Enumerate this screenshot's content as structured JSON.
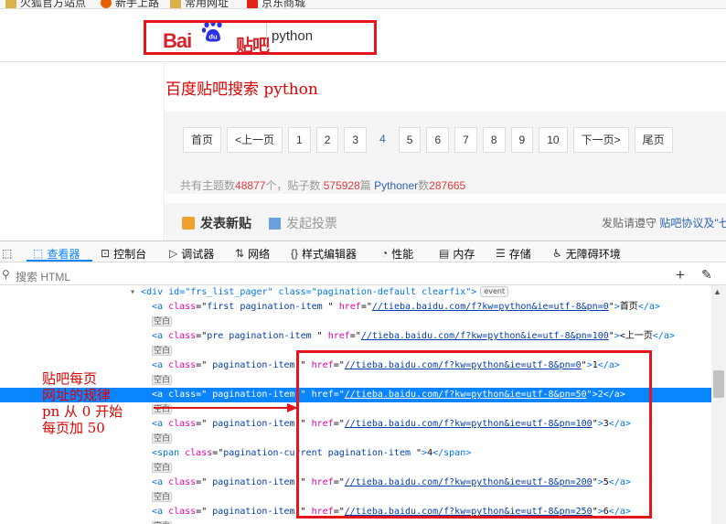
{
  "bookmarks": [
    {
      "label": "火狐官方站点",
      "icon": "folder-icon"
    },
    {
      "label": "新手上路",
      "icon": "firefox-icon"
    },
    {
      "label": "常用网址",
      "icon": "folder-icon"
    },
    {
      "label": "京东商城",
      "icon": "jd-icon"
    }
  ],
  "header": {
    "logo_bai": "Bai",
    "logo_du": "du",
    "logo_tieba": "贴吧",
    "search_value": "python"
  },
  "note_title": "百度贴吧搜索 python",
  "pager": {
    "items": [
      "首页",
      "<上一页",
      "1",
      "2",
      "3",
      "4",
      "5",
      "6",
      "7",
      "8",
      "9",
      "10",
      "下一页>",
      "尾页"
    ],
    "current": "4"
  },
  "stats": {
    "p1": "共有主题数",
    "topics": "48877",
    "p2": "个，贴子数 ",
    "posts": "575928",
    "p3": "篇 ",
    "member_label": "Pythoner",
    "p4": "数",
    "members": "287665"
  },
  "post_bar": {
    "new_post": "发表新贴",
    "vote": "发起投票",
    "rules_prefix": "发贴请遵守 ",
    "rules_link": "贴吧协议及\"七"
  },
  "devtools": {
    "tabs": [
      {
        "label": "查看器",
        "icon": "inspector-icon",
        "glyph": "⬚"
      },
      {
        "label": "控制台",
        "icon": "console-icon",
        "glyph": "⊡"
      },
      {
        "label": "调试器",
        "icon": "debugger-icon",
        "glyph": "▷"
      },
      {
        "label": "网络",
        "icon": "network-icon",
        "glyph": "⇅"
      },
      {
        "label": "样式编辑器",
        "icon": "style-editor-icon",
        "glyph": "{}"
      },
      {
        "label": "性能",
        "icon": "performance-icon",
        "glyph": "◔"
      },
      {
        "label": "内存",
        "icon": "memory-icon",
        "glyph": "▤"
      },
      {
        "label": "存储",
        "icon": "storage-icon",
        "glyph": "☰"
      },
      {
        "label": "无障碍环境",
        "icon": "accessibility-icon",
        "glyph": "♿"
      }
    ],
    "search_placeholder": "搜索 HTML",
    "whitespace_badge": "空白",
    "event_badge": "event",
    "top_line": "<div id=\"frs_list_pager\" class=\"pagination-default clearfix\">",
    "code_lines": [
      {
        "cls": "first pagination-item ",
        "href": "//tieba.baidu.com/f?kw=python&ie=utf-8&pn=0",
        "text": "首页"
      },
      {
        "cls": "pre pagination-item ",
        "href": "//tieba.baidu.com/f?kw=python&ie=utf-8&pn=100",
        "text": "<上一页"
      },
      {
        "cls": " pagination-item ",
        "href": "//tieba.baidu.com/f?kw=python&ie=utf-8&pn=0",
        "text": "1"
      },
      {
        "cls": " pagination-item ",
        "href": "//tieba.baidu.com/f?kw=python&ie=utf-8&pn=50",
        "text": "2",
        "selected": true
      },
      {
        "cls": " pagination-item ",
        "href": "//tieba.baidu.com/f?kw=python&ie=utf-8&pn=100",
        "text": "3"
      },
      {
        "span": true,
        "cls": "pagination-current pagination-item ",
        "text": "4"
      },
      {
        "cls": " pagination-item ",
        "href": "//tieba.baidu.com/f?kw=python&ie=utf-8&pn=200",
        "text": "5"
      },
      {
        "cls": " pagination-item ",
        "href": "//tieba.baidu.com/f?kw=python&ie=utf-8&pn=250",
        "text": "6"
      }
    ]
  },
  "annotation": [
    "贴吧每页",
    "网址的规律",
    "pn 从 0 开始",
    "每页加 50"
  ],
  "colors": {
    "annotation_red": "#e4151b",
    "tieba_red": "#d8232a",
    "devtools_blue": "#0a84ff"
  }
}
